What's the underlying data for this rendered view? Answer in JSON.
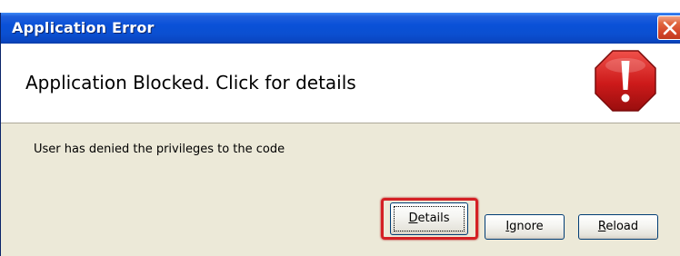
{
  "window": {
    "title": "Application Error",
    "close_icon": "close-icon"
  },
  "header": {
    "title": "Application Blocked. Click for details",
    "icon": "stop-error-icon",
    "icon_color": "#cc1a1a"
  },
  "body": {
    "message": "User has denied the privileges to the code"
  },
  "buttons": {
    "details": {
      "label_accel": "D",
      "label_rest": "etails"
    },
    "ignore": {
      "label_accel": "I",
      "label_rest": "gnore"
    },
    "reload": {
      "label_accel": "R",
      "label_rest": "eload"
    }
  },
  "highlight_color": "#d42024"
}
